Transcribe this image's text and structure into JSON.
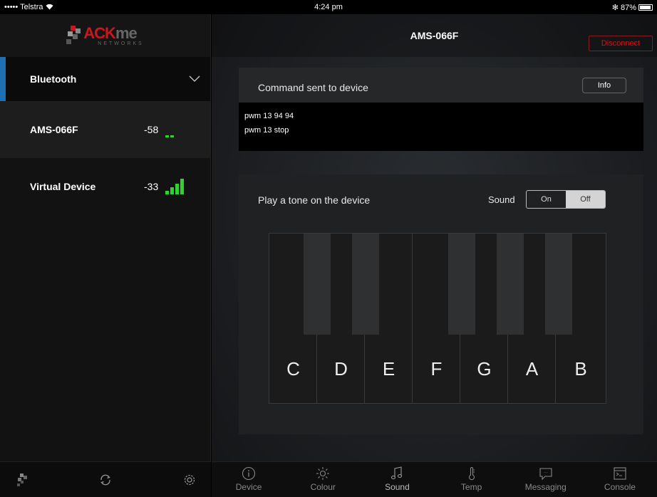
{
  "status_bar": {
    "carrier": "••••• Telstra ",
    "wifi_icon": "wifi-icon",
    "time": "4:24 pm",
    "bluetooth_glyph": "✻",
    "battery": "87%"
  },
  "sidebar": {
    "logo_ack": "ACK",
    "logo_me": "me",
    "logo_sub": "NETWORKS",
    "section_title": "Bluetooth",
    "devices": [
      {
        "name": "AMS-066F",
        "rssi": "-58",
        "signal_level": 2,
        "signal_max": 4
      },
      {
        "name": "Virtual Device",
        "rssi": "-33",
        "signal_level": 4,
        "signal_max": 4
      }
    ]
  },
  "header": {
    "title": "AMS-066F",
    "disconnect_label": "Disconnect"
  },
  "command_panel": {
    "label": "Command sent to device",
    "info_label": "Info",
    "log": [
      "pwm 13 94 94",
      "pwm 13 stop"
    ]
  },
  "tone_panel": {
    "label": "Play a tone on the device",
    "sound_label": "Sound",
    "on_label": "On",
    "off_label": "Off",
    "selected": "Off",
    "white_keys": [
      "C",
      "D",
      "E",
      "F",
      "G",
      "A",
      "B"
    ]
  },
  "tabs": [
    {
      "label": "Device",
      "icon": "info-icon"
    },
    {
      "label": "Colour",
      "icon": "sun-icon"
    },
    {
      "label": "Sound",
      "icon": "music-note-icon"
    },
    {
      "label": "Temp",
      "icon": "thermometer-icon"
    },
    {
      "label": "Messaging",
      "icon": "chat-bubble-icon"
    },
    {
      "label": "Console",
      "icon": "terminal-icon"
    }
  ],
  "colors": {
    "accent_blue": "#1f6fb4",
    "brand_red": "#d0141b",
    "signal_green": "#2dd42d"
  }
}
